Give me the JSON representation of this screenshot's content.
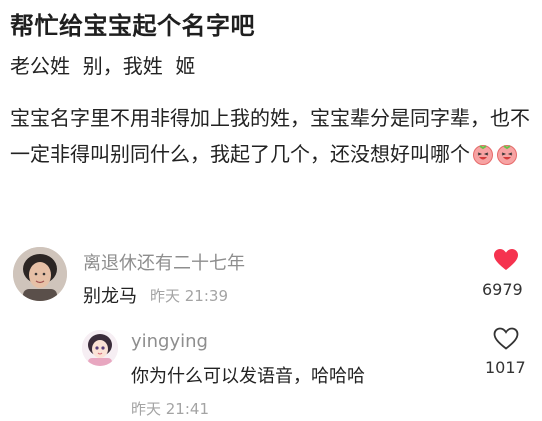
{
  "post": {
    "title": "帮忙给宝宝起个名字吧",
    "subtitle": "老公姓  别，我姓  姬",
    "body": "宝宝名字里不用非得加上我的姓，宝宝辈分是同字辈，也不一定非得叫别同什么，我起了几个，还没想好叫哪个",
    "emoji": "laughing-emoji"
  },
  "comments": [
    {
      "username": "离退休还有二十七年",
      "text": "别龙马",
      "time": "昨天 21:39",
      "likes": "6979",
      "liked": true,
      "like_color": "#f5334f"
    },
    {
      "username": "yingying",
      "text": "你为什么可以发语音，哈哈哈",
      "time": "昨天 21:41",
      "likes": "1017",
      "liked": false
    }
  ]
}
